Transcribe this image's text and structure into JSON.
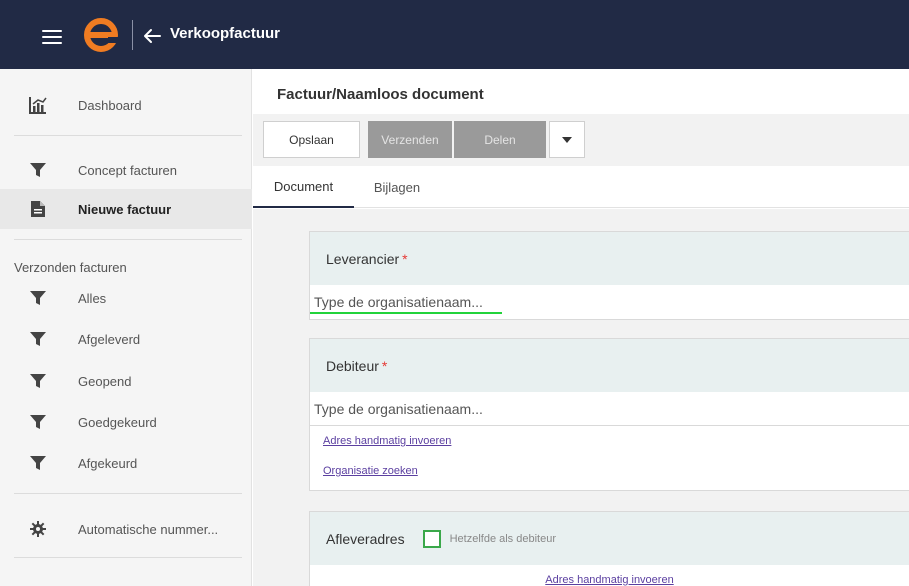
{
  "header": {
    "title": "Verkoopfactuur",
    "logo_letter": "e",
    "colors": {
      "bar": "#212a45",
      "logo": "#f07c22"
    }
  },
  "sidebar": {
    "items": [
      {
        "label": "Dashboard",
        "icon": "dashboard-chart-icon"
      },
      {
        "label": "Concept facturen",
        "icon": "filter-icon"
      },
      {
        "label": "Nieuwe factuur",
        "icon": "document-icon",
        "active": true
      }
    ],
    "section_label": "Verzonden facturen",
    "sent_items": [
      {
        "label": "Alles",
        "icon": "filter-icon"
      },
      {
        "label": "Afgeleverd",
        "icon": "filter-icon"
      },
      {
        "label": "Geopend",
        "icon": "filter-icon"
      },
      {
        "label": "Goedgekeurd",
        "icon": "filter-icon"
      },
      {
        "label": "Afgekeurd",
        "icon": "filter-icon"
      }
    ],
    "settings_item": {
      "label": "Automatische nummer...",
      "icon": "gear-icon"
    }
  },
  "main": {
    "doc_title": "Factuur/Naamloos document",
    "toolbar": {
      "save_label": "Opslaan",
      "send_label": "Verzenden",
      "share_label": "Delen"
    },
    "tabs": [
      {
        "label": "Document",
        "active": true
      },
      {
        "label": "Bijlagen"
      }
    ],
    "supplier": {
      "label": "Leverancier",
      "required_mark": "*",
      "placeholder": "Type de organisatienaam..."
    },
    "debtor": {
      "label": "Debiteur",
      "required_mark": "*",
      "placeholder": "Type de organisatienaam...",
      "link_manual": "Adres handmatig invoeren",
      "link_search": "Organisatie zoeken"
    },
    "delivery": {
      "label": "Afleveradres",
      "checkbox_label": "Hetzelfde als debiteur",
      "checkbox_checked": false,
      "link_manual": "Adres handmatig invoeren"
    }
  }
}
